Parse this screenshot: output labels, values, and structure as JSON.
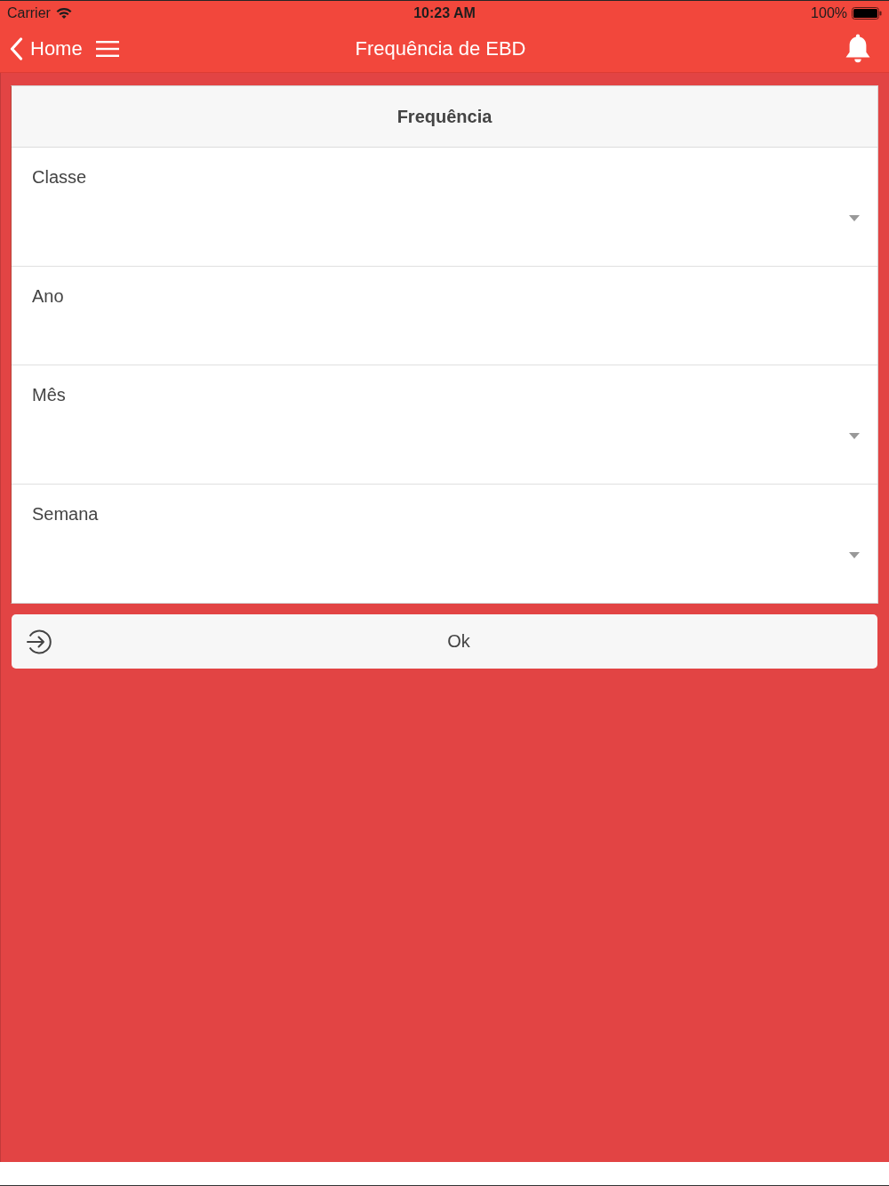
{
  "status_bar": {
    "carrier": "Carrier",
    "time": "10:23 AM",
    "battery": "100%"
  },
  "nav_bar": {
    "back_label": "Home",
    "title": "Frequência de EBD"
  },
  "form": {
    "title": "Frequência",
    "fields": [
      {
        "label": "Classe",
        "kind": "select"
      },
      {
        "label": "Ano",
        "kind": "text"
      },
      {
        "label": "Mês",
        "kind": "select"
      },
      {
        "label": "Semana",
        "kind": "select"
      }
    ]
  },
  "ok_button": {
    "label": "Ok"
  }
}
